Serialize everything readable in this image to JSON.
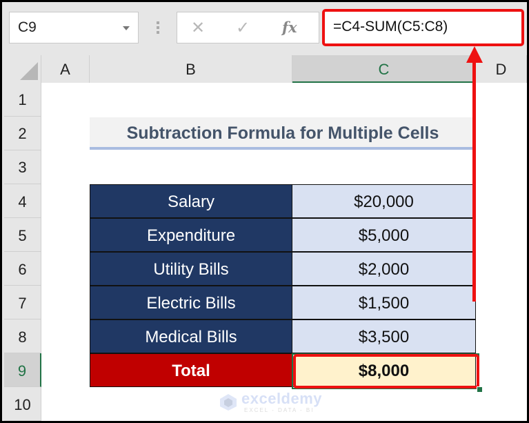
{
  "formula_bar": {
    "name_box": "C9",
    "cancel_icon": "cross-icon",
    "enter_icon": "checkmark-icon",
    "function_label": "fx",
    "formula": "=C4-SUM(C5:C8)"
  },
  "columns": [
    "A",
    "B",
    "C",
    "D"
  ],
  "selected_column": "C",
  "rows": [
    "1",
    "2",
    "3",
    "4",
    "5",
    "6",
    "7",
    "8",
    "9",
    "10"
  ],
  "selected_row": "9",
  "sheet": {
    "title": "Subtraction Formula for Multiple Cells",
    "table": [
      {
        "label": "Salary",
        "value": "$20,000"
      },
      {
        "label": "Expenditure",
        "value": "$5,000"
      },
      {
        "label": "Utility Bills",
        "value": "$2,000"
      },
      {
        "label": "Electric Bills",
        "value": "$1,500"
      },
      {
        "label": "Medical Bills",
        "value": "$3,500"
      }
    ],
    "total": {
      "label": "Total",
      "value": "$8,000"
    }
  },
  "watermark": {
    "name": "exceldemy",
    "tagline": "EXCEL - DATA - BI"
  },
  "colors": {
    "label_fill": "#203864",
    "value_fill": "#d9e1f2",
    "total_label_fill": "#c00000",
    "total_value_fill": "#fff2cc",
    "highlight": "#ee1111",
    "excel_green": "#217346"
  }
}
